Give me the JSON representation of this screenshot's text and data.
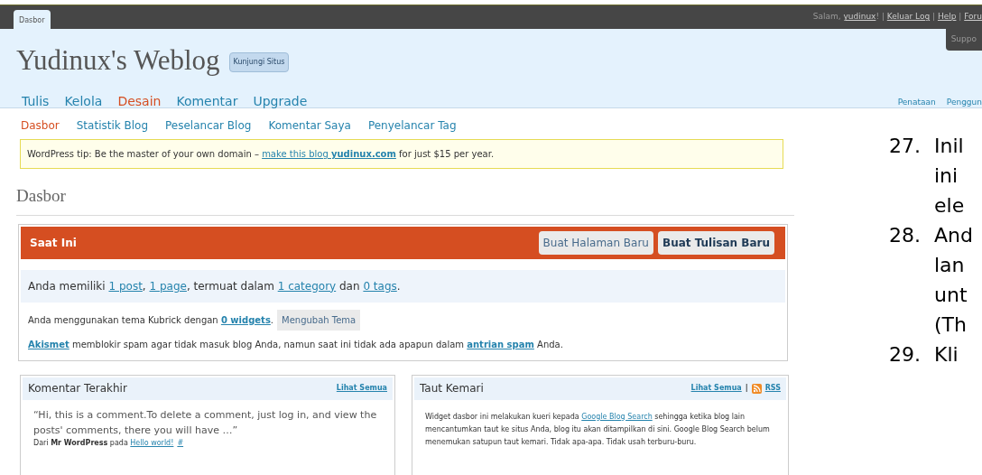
{
  "top_bar": {
    "tab": "Dasbor",
    "greeting": [
      {
        "kind": "plain",
        "text": "Salam, "
      },
      {
        "kind": "link",
        "text": "yudinux"
      },
      {
        "kind": "plain",
        "text": "! | "
      },
      {
        "kind": "link",
        "text": "Keluar Log"
      },
      {
        "kind": "plain",
        "text": " | "
      },
      {
        "kind": "link",
        "text": "Help"
      },
      {
        "kind": "plain",
        "text": " | "
      },
      {
        "kind": "link",
        "text": "Foru"
      }
    ],
    "support_tab": "Suppo"
  },
  "header": {
    "site_title": "Yudinux's Weblog",
    "visit_button": "Kunjungi Situs",
    "nav": [
      {
        "label": "Tulis",
        "selected": false
      },
      {
        "label": "Kelola",
        "selected": false
      },
      {
        "label": "Desain",
        "selected": true
      },
      {
        "label": "Komentar",
        "selected": false
      },
      {
        "label": "Upgrade",
        "selected": false
      }
    ],
    "nav_right": [
      "Penataan",
      "Penggun"
    ]
  },
  "subnav": [
    {
      "label": "Dasbor",
      "selected": true
    },
    {
      "label": "Statistik Blog",
      "selected": false
    },
    {
      "label": "Peselancar Blog",
      "selected": false
    },
    {
      "label": "Komentar Saya",
      "selected": false
    },
    {
      "label": "Penyelancar Tag",
      "selected": false
    }
  ],
  "tip": [
    {
      "kind": "plain",
      "text": "WordPress tip: Be the master of your own domain – "
    },
    {
      "kind": "link",
      "text": "make this blog **yudinux.com**"
    },
    {
      "kind": "plain",
      "text": " for just $15 per year."
    }
  ],
  "page_title": "Dasbor",
  "now_box": {
    "title": "Saat Ini",
    "buttons": [
      {
        "label": "Buat Halaman Baru",
        "primary": false
      },
      {
        "label": "Buat Tulisan Baru",
        "primary": true
      }
    ],
    "summary": [
      {
        "kind": "plain",
        "text": "Anda memiliki "
      },
      {
        "kind": "link",
        "text": "1 post"
      },
      {
        "kind": "plain",
        "text": ", "
      },
      {
        "kind": "link",
        "text": "1 page"
      },
      {
        "kind": "plain",
        "text": ", termuat dalam "
      },
      {
        "kind": "link",
        "text": "1 category"
      },
      {
        "kind": "plain",
        "text": " dan "
      },
      {
        "kind": "link",
        "text": "0 tags"
      },
      {
        "kind": "plain",
        "text": "."
      }
    ],
    "theme": [
      {
        "kind": "plain",
        "text": "Anda menggunakan tema Kubrick dengan "
      },
      {
        "kind": "link",
        "text": "0 widgets"
      },
      {
        "kind": "plain",
        "text": "."
      }
    ],
    "theme_button": "Mengubah Tema",
    "akismet": [
      {
        "kind": "link",
        "text": "Akismet"
      },
      {
        "kind": "plain",
        "text": " memblokir spam agar tidak masuk blog Anda, namun saat ini tidak ada apapun dalam "
      },
      {
        "kind": "link",
        "text": "antrian spam"
      },
      {
        "kind": "plain",
        "text": " Anda."
      }
    ]
  },
  "recent_comments": {
    "title": "Komentar Terakhir",
    "see_all": "Lihat Semua",
    "quote": "“Hi, this is a comment.To delete a comment, just log in, and view the posts' comments, there you will have …”",
    "byline": [
      {
        "kind": "plain",
        "text": "Dari **Mr WordPress** pada "
      },
      {
        "kind": "link",
        "text": "Hello world!"
      },
      {
        "kind": "spaced_link",
        "text": "#"
      }
    ]
  },
  "incoming_links": {
    "title": "Taut Kemari",
    "see_all": "Lihat Semua",
    "separator": "|",
    "rss": "RSS",
    "body": [
      {
        "kind": "plain",
        "text": "Widget dasbor ini melakukan kueri kepada "
      },
      {
        "kind": "link",
        "text": "Google Blog Search"
      },
      {
        "kind": "plain",
        "text": " sehingga ketika blog lain mencantumkan taut ke situs Anda, blog itu akan ditampilkan di sini. Google Blog Search belum menemukan satupun taut kemari. Tidak apa-apa. Tidak usah terburu-buru."
      }
    ]
  },
  "document_list": [
    {
      "number": "27.",
      "lines": [
        "Inil",
        "ini",
        "ele"
      ]
    },
    {
      "number": "28.",
      "lines": [
        "And",
        "lan",
        "unt",
        "(Th"
      ]
    },
    {
      "number": "29.",
      "lines": [
        "Kli"
      ]
    }
  ]
}
